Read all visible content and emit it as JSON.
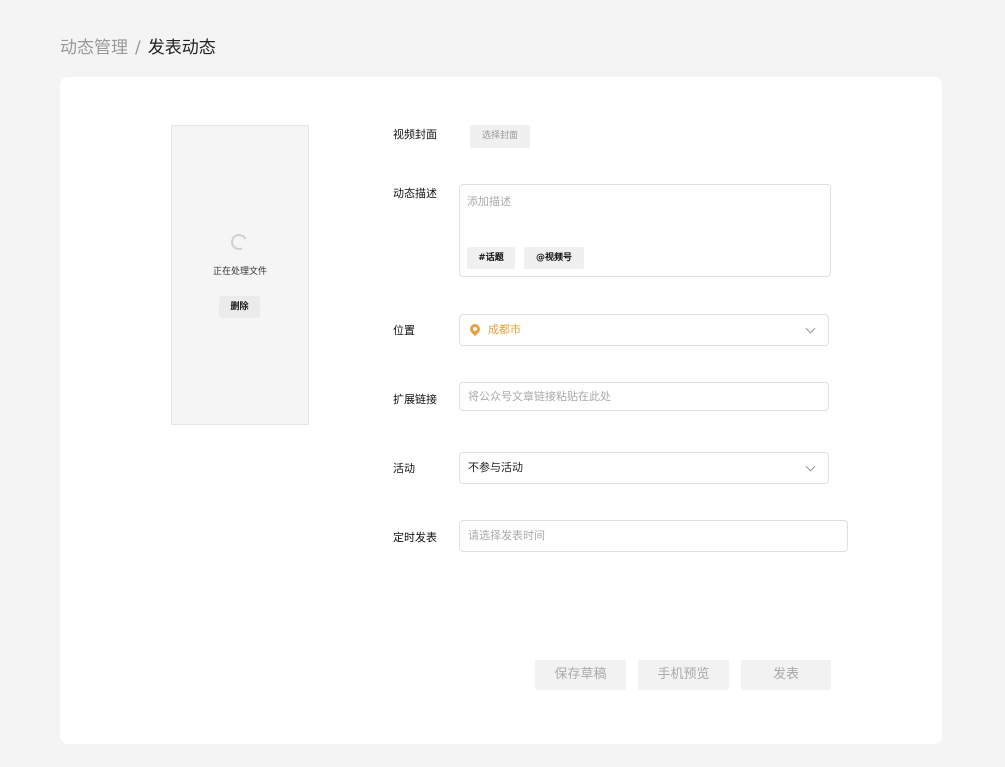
{
  "breadcrumb": {
    "parent": "动态管理",
    "separator": "/",
    "current": "发表动态"
  },
  "preview": {
    "status_text": "正在处理文件",
    "delete_label": "删除"
  },
  "form": {
    "cover": {
      "label": "视频封面",
      "button_label": "选择封面"
    },
    "description": {
      "label": "动态描述",
      "placeholder": "添加描述",
      "topic_tag": "#话题",
      "mention_tag": "@视频号"
    },
    "location": {
      "label": "位置",
      "value": "成都市",
      "icon": "map-pin-icon",
      "color": "#e6a23c"
    },
    "link": {
      "label": "扩展链接",
      "placeholder": "将公众号文章链接粘贴在此处"
    },
    "activity": {
      "label": "活动",
      "value": "不参与活动"
    },
    "schedule": {
      "label": "定时发表",
      "placeholder": "请选择发表时间"
    }
  },
  "actions": {
    "save_draft": "保存草稿",
    "phone_preview": "手机预览",
    "publish": "发表"
  }
}
